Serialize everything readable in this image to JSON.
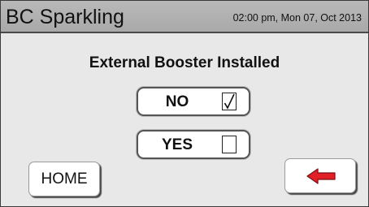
{
  "header": {
    "title": "BC Sparkling",
    "datetime": "02:00 pm, Mon 07, Oct 2013"
  },
  "main": {
    "heading": "External Booster Installed",
    "options": [
      {
        "label": "NO",
        "checked": true
      },
      {
        "label": "YES",
        "checked": false
      }
    ]
  },
  "footer": {
    "home_label": "HOME",
    "back_icon": "left-arrow-icon"
  },
  "colors": {
    "titlebar": "#afafaf",
    "background": "#e8e8e8",
    "arrow": "#e21e26"
  }
}
